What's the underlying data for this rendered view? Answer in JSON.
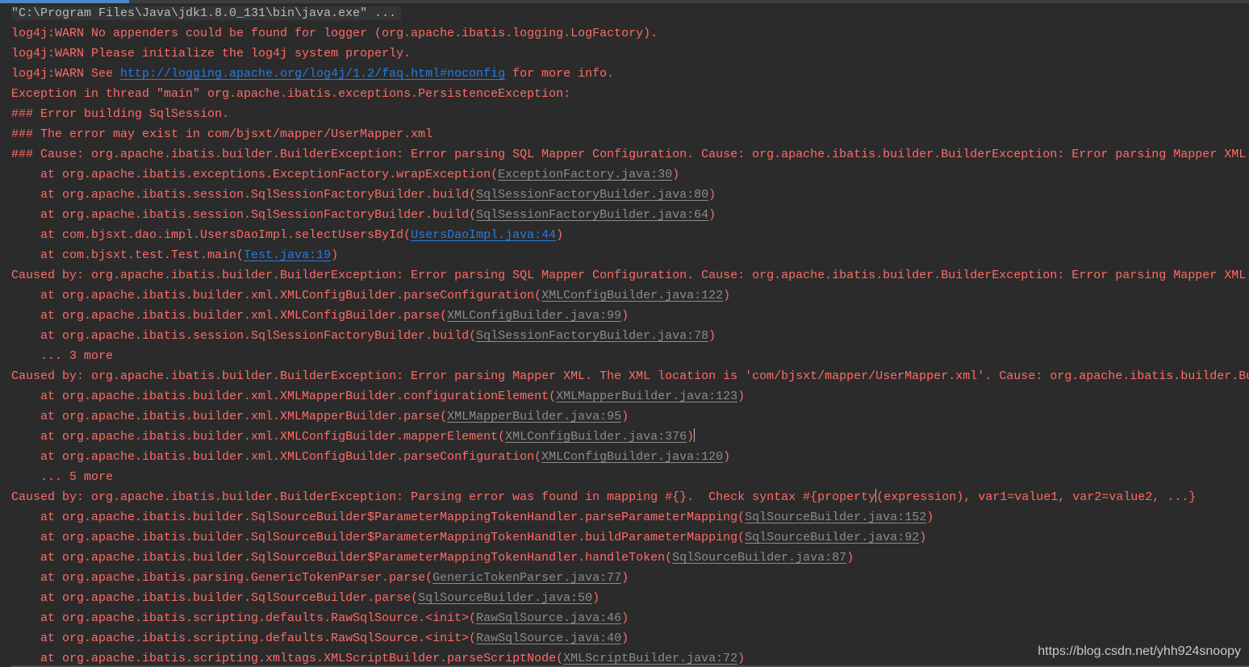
{
  "colors": {
    "background": "#2b2b2b",
    "error_text": "#ff6b68",
    "user_link": "#287bde",
    "library_link": "#8c8c8c",
    "command_text": "#bbbbbb"
  },
  "console": {
    "lines": [
      {
        "kind": "cmd",
        "segs": [
          {
            "t": "\"C:\\Program Files\\Java\\jdk1.8.0_131\\bin\\java.exe\" ...",
            "k": "text"
          }
        ]
      },
      {
        "segs": [
          {
            "t": "log4j:WARN No appenders could be found for logger (org.apache.ibatis.logging.LogFactory).",
            "k": "text"
          }
        ]
      },
      {
        "segs": [
          {
            "t": "log4j:WARN Please initialize the log4j system properly.",
            "k": "text"
          }
        ]
      },
      {
        "segs": [
          {
            "t": "log4j:WARN See ",
            "k": "text"
          },
          {
            "t": "http://logging.apache.org/log4j/1.2/faq.html#noconfig",
            "k": "link"
          },
          {
            "t": " for more info.",
            "k": "text"
          }
        ]
      },
      {
        "segs": [
          {
            "t": "Exception in thread \"main\" org.apache.ibatis.exceptions.PersistenceException:",
            "k": "text"
          }
        ]
      },
      {
        "segs": [
          {
            "t": "### Error building SqlSession.",
            "k": "text"
          }
        ]
      },
      {
        "segs": [
          {
            "t": "### The error may exist in com/bjsxt/mapper/UserMapper.xml",
            "k": "text"
          }
        ]
      },
      {
        "segs": [
          {
            "t": "### Cause: org.apache.ibatis.builder.BuilderException: Error parsing SQL Mapper Configuration. Cause: org.apache.ibatis.builder.BuilderException: Error parsing Mapper XML.",
            "k": "text"
          }
        ]
      },
      {
        "segs": [
          {
            "t": "    at org.apache.ibatis.exceptions.ExceptionFactory.wrapException(",
            "k": "text"
          },
          {
            "t": "ExceptionFactory.java:30",
            "k": "lib"
          },
          {
            "t": ")",
            "k": "text"
          }
        ]
      },
      {
        "segs": [
          {
            "t": "    at org.apache.ibatis.session.SqlSessionFactoryBuilder.build(",
            "k": "text"
          },
          {
            "t": "SqlSessionFactoryBuilder.java:80",
            "k": "lib"
          },
          {
            "t": ")",
            "k": "text"
          }
        ]
      },
      {
        "segs": [
          {
            "t": "    at org.apache.ibatis.session.SqlSessionFactoryBuilder.build(",
            "k": "text"
          },
          {
            "t": "SqlSessionFactoryBuilder.java:64",
            "k": "lib"
          },
          {
            "t": ")",
            "k": "text"
          }
        ]
      },
      {
        "segs": [
          {
            "t": "    at com.bjsxt.dao.impl.UsersDaoImpl.selectUsersById(",
            "k": "text"
          },
          {
            "t": "UsersDaoImpl.java:44",
            "k": "link"
          },
          {
            "t": ")",
            "k": "text"
          }
        ]
      },
      {
        "segs": [
          {
            "t": "    at com.bjsxt.test.Test.main(",
            "k": "text"
          },
          {
            "t": "Test.java:19",
            "k": "link"
          },
          {
            "t": ")",
            "k": "text"
          }
        ]
      },
      {
        "segs": [
          {
            "t": "Caused by: org.apache.ibatis.builder.BuilderException: Error parsing SQL Mapper Configuration. Cause: org.apache.ibatis.builder.BuilderException: Error parsing Mapper XML.",
            "k": "text"
          }
        ]
      },
      {
        "segs": [
          {
            "t": "    at org.apache.ibatis.builder.xml.XMLConfigBuilder.parseConfiguration(",
            "k": "text"
          },
          {
            "t": "XMLConfigBuilder.java:122",
            "k": "lib"
          },
          {
            "t": ")",
            "k": "text"
          }
        ]
      },
      {
        "segs": [
          {
            "t": "    at org.apache.ibatis.builder.xml.XMLConfigBuilder.parse(",
            "k": "text"
          },
          {
            "t": "XMLConfigBuilder.java:99",
            "k": "lib"
          },
          {
            "t": ")",
            "k": "text"
          }
        ]
      },
      {
        "segs": [
          {
            "t": "    at org.apache.ibatis.session.SqlSessionFactoryBuilder.build(",
            "k": "text"
          },
          {
            "t": "SqlSessionFactoryBuilder.java:78",
            "k": "lib"
          },
          {
            "t": ")",
            "k": "text"
          }
        ]
      },
      {
        "segs": [
          {
            "t": "    ... 3 more",
            "k": "text"
          }
        ]
      },
      {
        "segs": [
          {
            "t": "Caused by: org.apache.ibatis.builder.BuilderException: Error parsing Mapper XML. The XML location is 'com/bjsxt/mapper/UserMapper.xml'. Cause: org.apache.ibatis.builder.Bu",
            "k": "text"
          }
        ]
      },
      {
        "segs": [
          {
            "t": "    at org.apache.ibatis.builder.xml.XMLMapperBuilder.configurationElement(",
            "k": "text"
          },
          {
            "t": "XMLMapperBuilder.java:123",
            "k": "lib"
          },
          {
            "t": ")",
            "k": "text"
          }
        ]
      },
      {
        "segs": [
          {
            "t": "    at org.apache.ibatis.builder.xml.XMLMapperBuilder.parse(",
            "k": "text"
          },
          {
            "t": "XMLMapperBuilder.java:95",
            "k": "lib"
          },
          {
            "t": ")",
            "k": "text"
          }
        ]
      },
      {
        "segs": [
          {
            "t": "    at org.apache.ibatis.builder.xml.XMLConfigBuilder.mapperElement(",
            "k": "text"
          },
          {
            "t": "XMLConfigBuilder.java:376",
            "k": "lib"
          },
          {
            "t": ")",
            "k": "text"
          },
          {
            "t": "",
            "k": "caret"
          }
        ]
      },
      {
        "segs": [
          {
            "t": "    at org.apache.ibatis.builder.xml.XMLConfigBuilder.parseConfiguration(",
            "k": "text"
          },
          {
            "t": "XMLConfigBuilder.java:120",
            "k": "lib"
          },
          {
            "t": ")",
            "k": "text"
          }
        ]
      },
      {
        "segs": [
          {
            "t": "    ... 5 more",
            "k": "text"
          }
        ]
      },
      {
        "segs": [
          {
            "t": "Caused by: org.apache.ibatis.builder.BuilderException: Parsing error was found in mapping #{}.  Check syntax #{property",
            "k": "text"
          },
          {
            "t": "",
            "k": "caret"
          },
          {
            "t": "(expression), var1=value1, var2=value2, ...}",
            "k": "text"
          }
        ]
      },
      {
        "segs": [
          {
            "t": "    at org.apache.ibatis.builder.SqlSourceBuilder$ParameterMappingTokenHandler.parseParameterMapping(",
            "k": "text"
          },
          {
            "t": "SqlSourceBuilder.java:152",
            "k": "lib"
          },
          {
            "t": ")",
            "k": "text"
          }
        ]
      },
      {
        "segs": [
          {
            "t": "    at org.apache.ibatis.builder.SqlSourceBuilder$ParameterMappingTokenHandler.buildParameterMapping(",
            "k": "text"
          },
          {
            "t": "SqlSourceBuilder.java:92",
            "k": "lib"
          },
          {
            "t": ")",
            "k": "text"
          }
        ]
      },
      {
        "segs": [
          {
            "t": "    at org.apache.ibatis.builder.SqlSourceBuilder$ParameterMappingTokenHandler.handleToken(",
            "k": "text"
          },
          {
            "t": "SqlSourceBuilder.java:87",
            "k": "lib"
          },
          {
            "t": ")",
            "k": "text"
          }
        ]
      },
      {
        "segs": [
          {
            "t": "    at org.apache.ibatis.parsing.GenericTokenParser.parse(",
            "k": "text"
          },
          {
            "t": "GenericTokenParser.java:77",
            "k": "lib"
          },
          {
            "t": ")",
            "k": "text"
          }
        ]
      },
      {
        "segs": [
          {
            "t": "    at org.apache.ibatis.builder.SqlSourceBuilder.parse(",
            "k": "text"
          },
          {
            "t": "SqlSourceBuilder.java:50",
            "k": "lib"
          },
          {
            "t": ")",
            "k": "text"
          }
        ]
      },
      {
        "segs": [
          {
            "t": "    at org.apache.ibatis.scripting.defaults.RawSqlSource.<init>(",
            "k": "text"
          },
          {
            "t": "RawSqlSource.java:46",
            "k": "lib"
          },
          {
            "t": ")",
            "k": "text"
          }
        ]
      },
      {
        "segs": [
          {
            "t": "    at org.apache.ibatis.scripting.defaults.RawSqlSource.<init>(",
            "k": "text"
          },
          {
            "t": "RawSqlSource.java:40",
            "k": "lib"
          },
          {
            "t": ")",
            "k": "text"
          }
        ]
      },
      {
        "segs": [
          {
            "t": "    at org.apache.ibatis.scripting.xmltags.XMLScriptBuilder.parseScriptNode(",
            "k": "text"
          },
          {
            "t": "XMLScriptBuilder.java:72",
            "k": "lib"
          },
          {
            "t": ")",
            "k": "text"
          }
        ]
      }
    ]
  },
  "watermark": "https://blog.csdn.net/yhh924snoopy"
}
